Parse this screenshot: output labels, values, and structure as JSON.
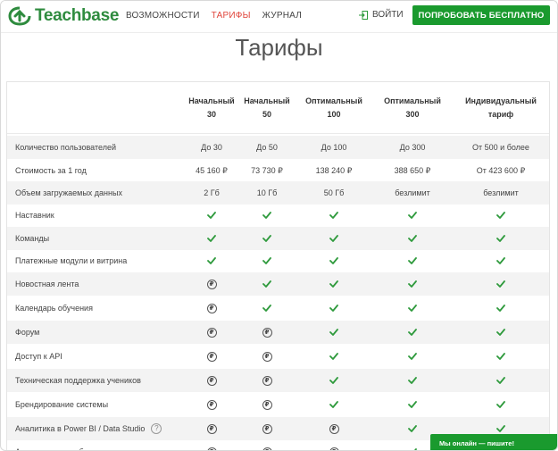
{
  "header": {
    "logo_text": "Teachbase",
    "nav": [
      "Возможности",
      "Тарифы",
      "Журнал"
    ],
    "active_nav": 1,
    "login_label": "Войти",
    "try_button": "Попробовать бесплатно"
  },
  "page": {
    "title": "Тарифы"
  },
  "plans": [
    {
      "line1": "Начальный",
      "line2": "30"
    },
    {
      "line1": "Начальный",
      "line2": "50"
    },
    {
      "line1": "Оптимальный",
      "line2": "100"
    },
    {
      "line1": "Оптимальный",
      "line2": "300"
    },
    {
      "line1": "Индивидуальный",
      "line2": "тариф"
    }
  ],
  "rows": [
    {
      "label": "Количество пользователей",
      "cells": [
        "До 30",
        "До 50",
        "До 100",
        "До 300",
        "От 500 и более"
      ]
    },
    {
      "label": "Стоимость за 1 год",
      "cells": [
        "45 160 ₽",
        "73 730 ₽",
        "138 240 ₽",
        "388 650 ₽",
        "От 423 600 ₽"
      ]
    },
    {
      "label": "Объем загружаемых данных",
      "cells": [
        "2 Гб",
        "10 Гб",
        "50 Гб",
        "безлимит",
        "безлимит"
      ]
    },
    {
      "label": "Наставник",
      "cells": [
        "check",
        "check",
        "check",
        "check",
        "check"
      ]
    },
    {
      "label": "Команды",
      "cells": [
        "check",
        "check",
        "check",
        "check",
        "check"
      ]
    },
    {
      "label": "Платежные модули и витрина",
      "cells": [
        "check",
        "check",
        "check",
        "check",
        "check"
      ]
    },
    {
      "label": "Новостная лента",
      "cells": [
        "paid",
        "check",
        "check",
        "check",
        "check"
      ]
    },
    {
      "label": "Календарь обучения",
      "cells": [
        "paid",
        "check",
        "check",
        "check",
        "check"
      ]
    },
    {
      "label": "Форум",
      "cells": [
        "paid",
        "paid",
        "check",
        "check",
        "check"
      ]
    },
    {
      "label": "Доступ к API",
      "cells": [
        "paid",
        "paid",
        "check",
        "check",
        "check"
      ]
    },
    {
      "label": "Техническая поддержка учеников",
      "cells": [
        "paid",
        "paid",
        "check",
        "check",
        "check"
      ]
    },
    {
      "label": "Брендирование системы",
      "cells": [
        "paid",
        "paid",
        "check",
        "check",
        "check"
      ]
    },
    {
      "label": "Аналитика в Power BI / Data Studio",
      "help": "?",
      "cells": [
        "paid",
        "paid",
        "paid",
        "check",
        "check"
      ]
    },
    {
      "label": "Автоматизация обучения",
      "cells": [
        "paid",
        "paid",
        "paid",
        "check",
        "check"
      ]
    }
  ],
  "paid_symbol": "₽",
  "chat_label": "Мы онлайн — пишите!",
  "colors": {
    "brand": "#1a9a2e",
    "active_nav": "#e0463c",
    "check": "#2e9a3c"
  }
}
